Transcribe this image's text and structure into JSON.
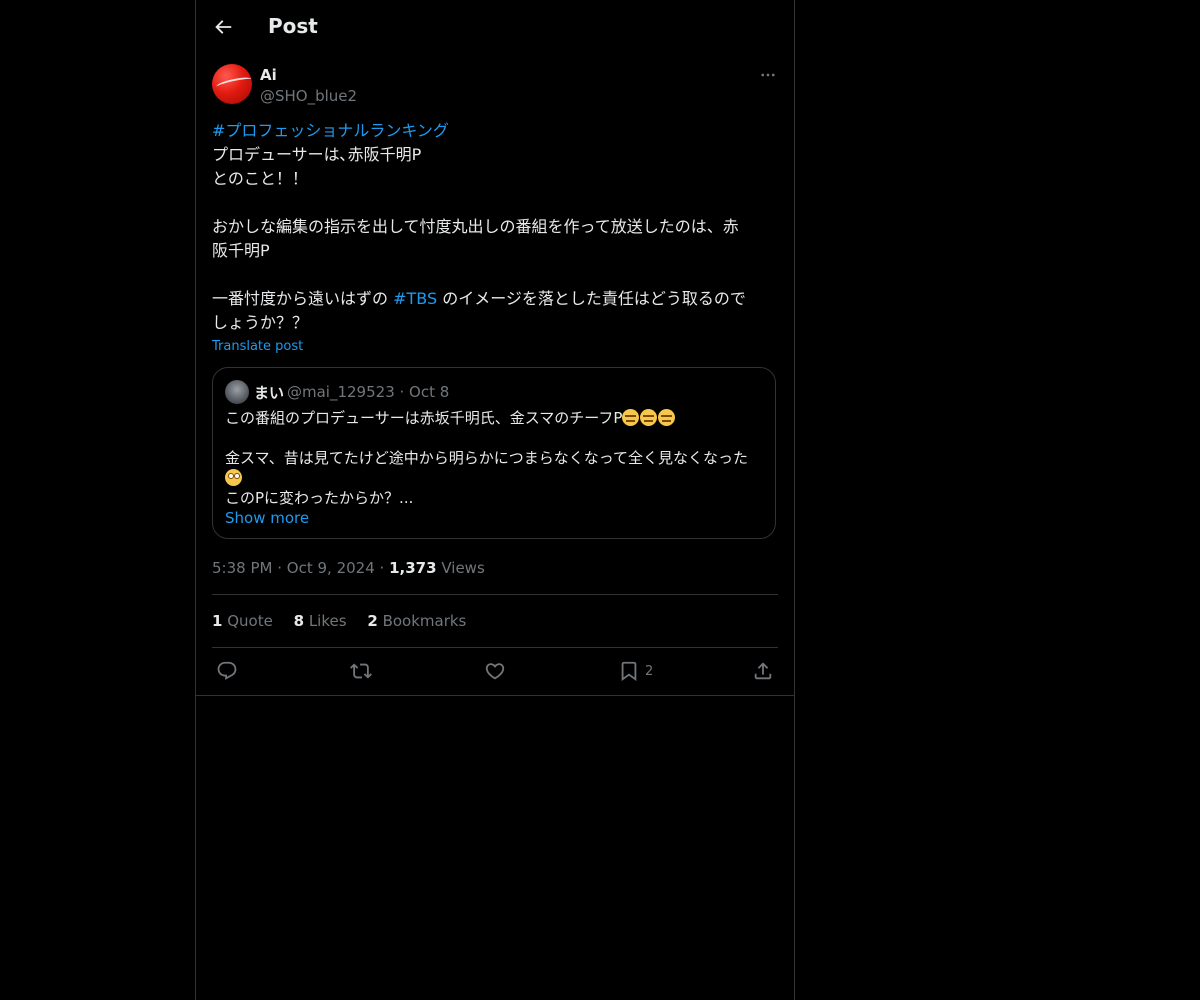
{
  "header": {
    "title": "Post"
  },
  "post": {
    "author_name": "Ai",
    "author_handle": "@SHO_blue2",
    "hashtag_1": "#プロフェッショナルランキング",
    "line_1": "プロデューサーは､赤阪千明P",
    "line_2": "とのこと！！",
    "line_3": "おかしな編集の指示を出して忖度丸出しの番組を作って放送したのは、赤",
    "line_4": "阪千明P",
    "line_5_pre": "一番忖度から遠いはずの ",
    "hashtag_2": "#TBS",
    "line_5_post": " のイメージを落とした責任はどう取るので",
    "line_6": "しょうか？？",
    "translate_label": "Translate post"
  },
  "quote": {
    "name": "まい",
    "meta": "@mai_129523 · Oct 8",
    "line_1": "この番組のプロデューサーは赤坂千明氏、金スマのチーフP",
    "line_2": "金スマ、昔は見てたけど途中から明らかにつまらなくなって全く見なくなった",
    "line_3": "このPに変わったからか？...",
    "show_more": "Show more"
  },
  "meta": {
    "time": "5:38 PM",
    "sep": "·",
    "date": "Oct 9, 2024",
    "views_count": "1,373",
    "views_label": "Views"
  },
  "stats": {
    "quotes_count": "1",
    "quotes_label": "Quote",
    "likes_count": "8",
    "likes_label": "Likes",
    "bookmarks_count": "2",
    "bookmarks_label": "Bookmarks"
  },
  "actions": {
    "bookmark_count": "2"
  },
  "icons": [
    "back-arrow-icon",
    "more-icon",
    "reply-icon",
    "retweet-icon",
    "like-icon",
    "bookmark-icon",
    "share-icon"
  ],
  "colors": {
    "accent": "#1d9bf0",
    "muted": "#71767b",
    "border": "#2f3336",
    "background": "#000000"
  }
}
